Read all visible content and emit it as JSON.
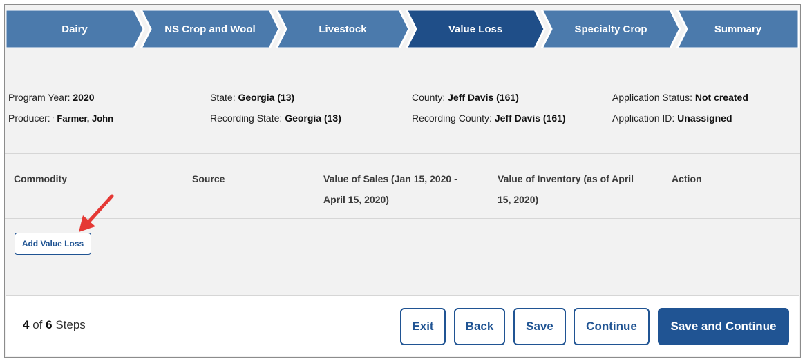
{
  "wizard": {
    "steps": [
      {
        "label": "Dairy",
        "active": false
      },
      {
        "label": "NS Crop and Wool",
        "active": false
      },
      {
        "label": "Livestock",
        "active": false
      },
      {
        "label": "Value Loss",
        "active": true
      },
      {
        "label": "Specialty Crop",
        "active": false
      },
      {
        "label": "Summary",
        "active": false
      }
    ],
    "colors": {
      "inactive": "#4b7aac",
      "active": "#1f4e88"
    }
  },
  "info": {
    "program_year": {
      "label": "Program Year:",
      "value": "2020"
    },
    "producer": {
      "label": "Producer:",
      "mark": "'",
      "value": "Farmer, John"
    },
    "state": {
      "label": "State:",
      "value": "Georgia (13)"
    },
    "recording_state": {
      "label": "Recording State:",
      "value": "Georgia (13)"
    },
    "county": {
      "label": "County:",
      "value": "Jeff Davis (161)"
    },
    "recording_county": {
      "label": "Recording County:",
      "value": "Jeff Davis (161)"
    },
    "application_status": {
      "label": "Application Status:",
      "value": "Not created"
    },
    "application_id": {
      "label": "Application ID:",
      "value": "Unassigned"
    }
  },
  "table": {
    "headers": {
      "commodity": "Commodity",
      "source": "Source",
      "sales_line1": "Value of Sales (Jan 15, 2020 -",
      "sales_line2": "April 15, 2020)",
      "inventory_line1": "Value of Inventory (as of April",
      "inventory_line2": "15, 2020)",
      "action": "Action"
    },
    "add_button": "Add Value Loss"
  },
  "footer": {
    "current_step": "4",
    "of_text": "of",
    "total_steps": "6",
    "steps_text": "Steps",
    "buttons": {
      "exit": "Exit",
      "back": "Back",
      "save": "Save",
      "continue": "Continue",
      "save_and_continue": "Save and Continue"
    }
  },
  "annotation": {
    "arrow_color": "#e53935",
    "icon": "red-arrow-icon"
  }
}
